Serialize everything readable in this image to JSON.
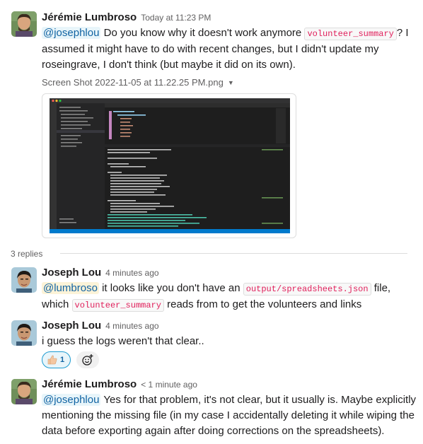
{
  "parent": {
    "author": "Jérémie Lumbroso",
    "time": "Today at 11:23 PM",
    "mention": "@josephlou",
    "text_1": " Do you know why it doesn't work anymore ",
    "code_1": "volunteer_summary",
    "text_2a": "? I",
    "text_2b": "assumed it might have to do with recent changes, but I didn't update my",
    "text_2c": "roseingrave, I don't think (but maybe it did on its own).",
    "file_name": "Screen Shot 2022-11-05 at 11.22.25 PM.png",
    "file_caret": "▼"
  },
  "replies_label": "3 replies",
  "reply_1": {
    "author": "Joseph Lou",
    "time": "4 minutes ago",
    "mention": "@lumbroso",
    "text_1": " it looks like you don't have an ",
    "code_1": "output/spreadsheets.json",
    "text_2": " file,",
    "text_3": "which ",
    "code_2": "volunteer_summary",
    "text_4": " reads from to get the volunteers and links"
  },
  "reply_2": {
    "author": "Joseph Lou",
    "time": "4 minutes ago",
    "text": "i guess the logs weren't that clear..",
    "reaction_count": "1"
  },
  "reply_3": {
    "author": "Jérémie Lumbroso",
    "time": "< 1 minute ago",
    "mention": "@josephlou",
    "text_1": " Yes for that problem, it's not clear, but it usually is. Maybe explicitly",
    "text_2": "mentioning the missing file (in my case I accidentally deleting it while wiping the",
    "text_3": "data before exporting again after doing corrections on the spreadsheets)."
  },
  "colors": {
    "mention_bg": "#e8f5fa",
    "mention_self_bg": "#fcf3d8",
    "link_blue": "#1264a3",
    "code_red": "#e01e5a",
    "editor_bg": "#1e1e1e",
    "statusbar_blue": "#007acc"
  }
}
